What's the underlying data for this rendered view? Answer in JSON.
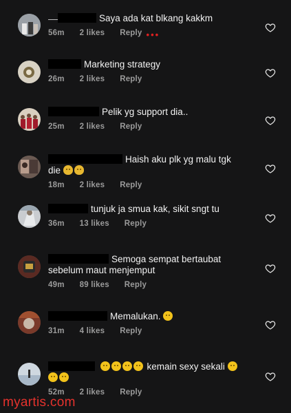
{
  "comments": [
    {
      "text": "Saya ada kat blkang kakkm",
      "time": "56m",
      "likes": "2 likes",
      "reply": "Reply"
    },
    {
      "text": "Marketing strategy",
      "time": "26m",
      "likes": "2 likes",
      "reply": "Reply"
    },
    {
      "text": "Pelik yg support dia..",
      "time": "25m",
      "likes": "2 likes",
      "reply": "Reply"
    },
    {
      "text": "Haish aku plk yg malu tgk",
      "text2": "die",
      "time": "18m",
      "likes": "2 likes",
      "reply": "Reply"
    },
    {
      "text": "tunjuk ja smua kak,  sikit sngt tu",
      "time": "36m",
      "likes": "13 likes",
      "reply": "Reply"
    },
    {
      "text": "Semoga sempat bertaubat",
      "text2": "sebelum maut menjemput",
      "time": "49m",
      "likes": "89 likes",
      "reply": "Reply"
    },
    {
      "text": "Memalukan.",
      "time": "31m",
      "likes": "4 likes",
      "reply": "Reply"
    },
    {
      "text": "kemain sexy sekali",
      "time": "52m",
      "likes": "2 likes",
      "reply": "Reply"
    }
  ],
  "watermark": "myartis.com",
  "colors": {
    "background": "#151516",
    "meta": "#9b9b9b",
    "watermark": "#e5322d",
    "emoji": "#f2c21b"
  }
}
